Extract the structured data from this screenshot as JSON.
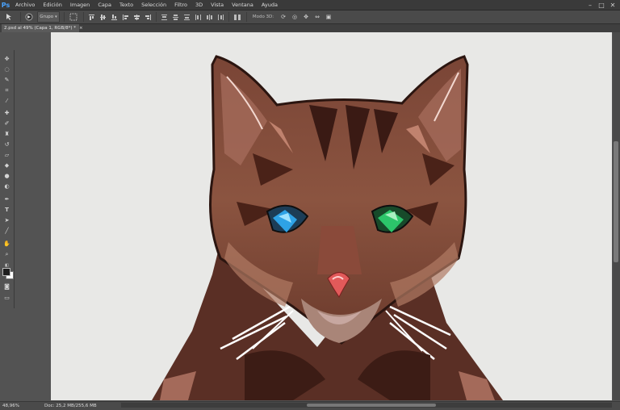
{
  "app": {
    "logo": "Ps"
  },
  "menu": [
    "Archivo",
    "Edición",
    "Imagen",
    "Capa",
    "Texto",
    "Selección",
    "Filtro",
    "3D",
    "Vista",
    "Ventana",
    "Ayuda"
  ],
  "window_controls": {
    "minimize": "–",
    "maximize": "□",
    "close": "✕"
  },
  "options_bar": {
    "tool_icon": "move-tool-icon",
    "auto_select_value": "Grupo",
    "mode_3d_label": "Modo 3D:"
  },
  "document_tab": {
    "title": "2.psd al 49% (Capa 1, RGB/8*) *",
    "close": "×"
  },
  "tools": [
    {
      "name": "move-tool-icon",
      "glyph": "✥"
    },
    {
      "name": "lasso-tool-icon",
      "glyph": "◌"
    },
    {
      "name": "quick-select-tool-icon",
      "glyph": "✎"
    },
    {
      "name": "crop-tool-icon",
      "glyph": "⌗"
    },
    {
      "name": "eyedropper-tool-icon",
      "glyph": "⁄"
    },
    {
      "name": "healing-brush-tool-icon",
      "glyph": "✚"
    },
    {
      "name": "brush-tool-icon",
      "glyph": "✐"
    },
    {
      "name": "clone-stamp-tool-icon",
      "glyph": "♜"
    },
    {
      "name": "history-brush-tool-icon",
      "glyph": "↺"
    },
    {
      "name": "eraser-tool-icon",
      "glyph": "▱"
    },
    {
      "name": "paint-bucket-tool-icon",
      "glyph": "◆"
    },
    {
      "name": "blur-tool-icon",
      "glyph": "●"
    },
    {
      "name": "dodge-tool-icon",
      "glyph": "◐"
    },
    {
      "name": "pen-tool-icon",
      "glyph": "✒"
    },
    {
      "name": "type-tool-icon",
      "glyph": "T"
    },
    {
      "name": "path-selection-tool-icon",
      "glyph": "➤"
    },
    {
      "name": "line-tool-icon",
      "glyph": "╱"
    },
    {
      "name": "hand-tool-icon",
      "glyph": "✋"
    },
    {
      "name": "zoom-tool-icon",
      "glyph": "⌕"
    }
  ],
  "colors": {
    "foreground": "#1f1f1f",
    "background": "#ffffff",
    "accent": "#4aa3ff"
  },
  "status": {
    "zoom": "48,96%",
    "doc_info": "Doc: 25,2 MB/255,6 MB"
  }
}
